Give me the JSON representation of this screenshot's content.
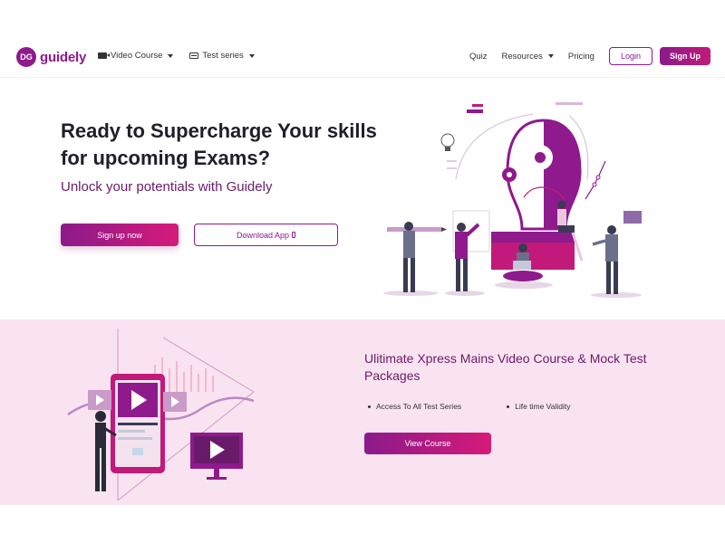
{
  "brand": {
    "logo_badge": "DG",
    "name": "guidely"
  },
  "nav": {
    "video_course": "Video Course",
    "test_series": "Test series",
    "quiz": "Quiz",
    "resources": "Resources",
    "pricing": "Pricing",
    "login": "Login",
    "signup": "Sign Up"
  },
  "hero": {
    "title": "Ready to Supercharge Your skills for upcoming Exams?",
    "subtitle": "Unlock your potentials with Guidely",
    "signup_button": "Sign up now",
    "download_button": "Download App"
  },
  "promo": {
    "title": "Ulitimate Xpress Mains Video Course & Mock Test Packages",
    "features": [
      "Access To All Test Series",
      "Life time Validity"
    ],
    "cta": "View Course"
  },
  "colors": {
    "brand": "#8e1a8c",
    "accent": "#d61a7a",
    "promo_bg": "#fae3f0"
  },
  "icons": [
    "video-icon",
    "test-series-icon",
    "chevron-down-icon",
    "mobile-icon"
  ]
}
